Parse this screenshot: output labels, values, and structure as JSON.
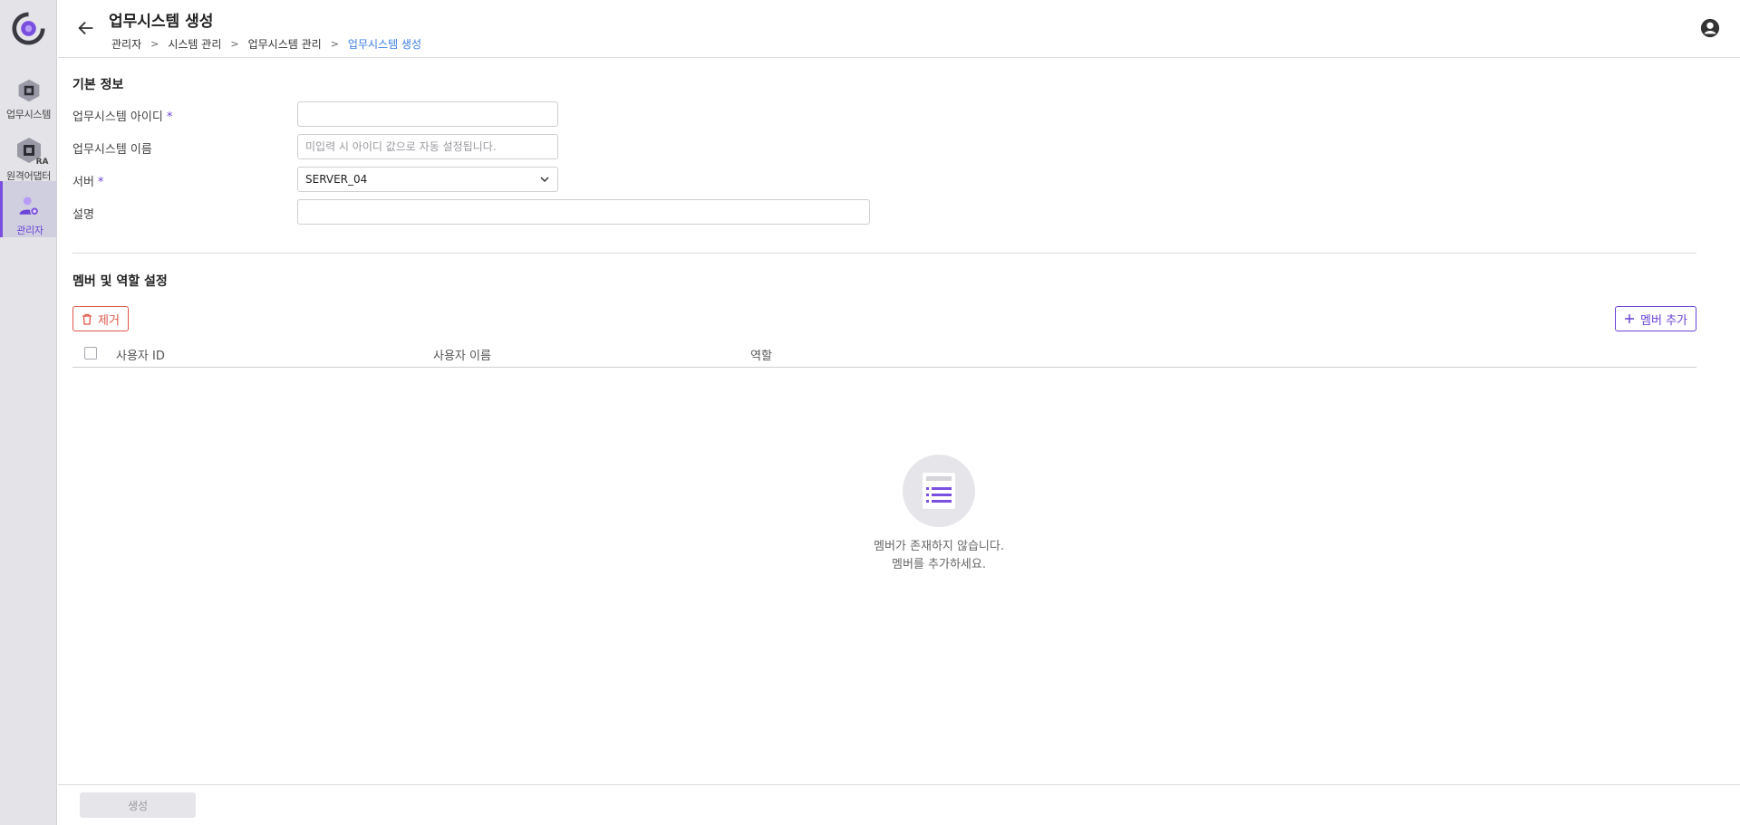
{
  "sidebar": {
    "items": [
      {
        "label": "업무시스템",
        "icon": "cube-icon"
      },
      {
        "label": "원격어댑터",
        "icon": "remote-adapter-icon",
        "tag": "RA"
      },
      {
        "label": "관리자",
        "icon": "admin-user-icon"
      }
    ],
    "active": "관리자"
  },
  "header": {
    "title": "업무시스템 생성",
    "breadcrumb": [
      "관리자",
      "시스템 관리",
      "업무시스템 관리",
      "업무시스템 생성"
    ]
  },
  "basic_info": {
    "title": "기본 정보",
    "fields": {
      "id": {
        "label": "업무시스템 아이디",
        "value": "",
        "placeholder": ""
      },
      "name": {
        "label": "업무시스템 이름",
        "value": "",
        "placeholder": "미입력 시 아이디 값으로 자동 설정됩니다."
      },
      "server": {
        "label": "서버",
        "value": "SERVER_04"
      },
      "description": {
        "label": "설명",
        "value": "",
        "placeholder": ""
      }
    },
    "required_mark": "*"
  },
  "members": {
    "title": "멤버 및 역할 설정",
    "remove_label": "제거",
    "add_label": "멤버 추가",
    "columns": [
      "사용자 ID",
      "사용자 이름",
      "역할"
    ],
    "rows": [],
    "empty_line1": "멤버가 존재하지 않습니다.",
    "empty_line2": "멤버를 추가하세요."
  },
  "footer": {
    "create_label": "생성"
  },
  "colors": {
    "accent": "#6b43d6",
    "danger": "#e05548",
    "link": "#3c7ee0"
  }
}
